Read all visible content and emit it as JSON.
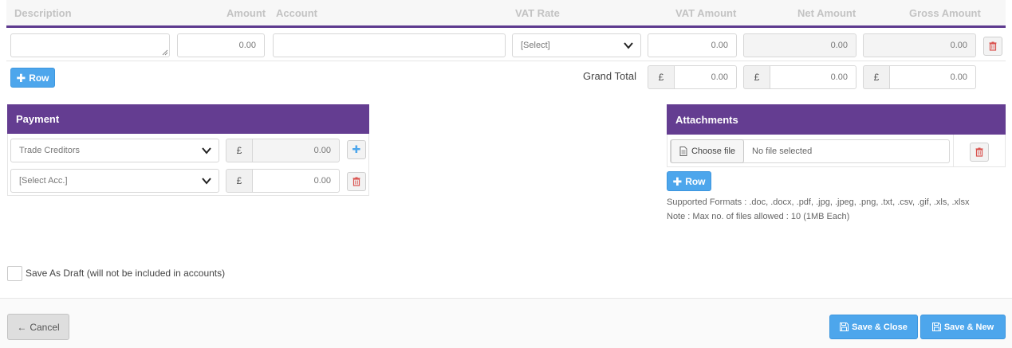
{
  "table": {
    "headers": [
      "Description",
      "Amount",
      "Account",
      "VAT Rate",
      "VAT Amount",
      "Net Amount",
      "Gross Amount"
    ],
    "row": {
      "description": "",
      "amount": "0.00",
      "account": "",
      "vat_rate": "[Select]",
      "vat_amount": "0.00",
      "net_amount": "0.00",
      "gross_amount": "0.00"
    },
    "add_row_label": "Row",
    "grand_total_label": "Grand Total",
    "currency_symbol": "£",
    "totals": {
      "vat_amount": "0.00",
      "net_amount": "0.00",
      "gross_amount": "0.00"
    }
  },
  "payment": {
    "title": "Payment",
    "rows": [
      {
        "account": "Trade Creditors",
        "currency": "£",
        "amount": "0.00"
      },
      {
        "account": "[Select Acc.]",
        "currency": "£",
        "amount": "0.00"
      }
    ]
  },
  "attachments": {
    "title": "Attachments",
    "choose_file_label": "Choose file",
    "file_status": "No file selected",
    "add_row_label": "Row",
    "supported_formats": "Supported Formats : .doc, .docx, .pdf, .jpg, .jpeg, .png, .txt, .csv, .gif, .xls, .xlsx",
    "note": "Note : Max no. of files allowed : 10 (1MB Each)"
  },
  "draft": {
    "label": "Save As Draft (will not be included in accounts)",
    "checked": false
  },
  "footer": {
    "cancel_label": "Cancel",
    "save_close_label": "Save & Close",
    "save_new_label": "Save & New"
  },
  "colors": {
    "accent_purple": "#643d91",
    "button_blue": "#4da6ec",
    "delete_red": "#d9534f"
  }
}
